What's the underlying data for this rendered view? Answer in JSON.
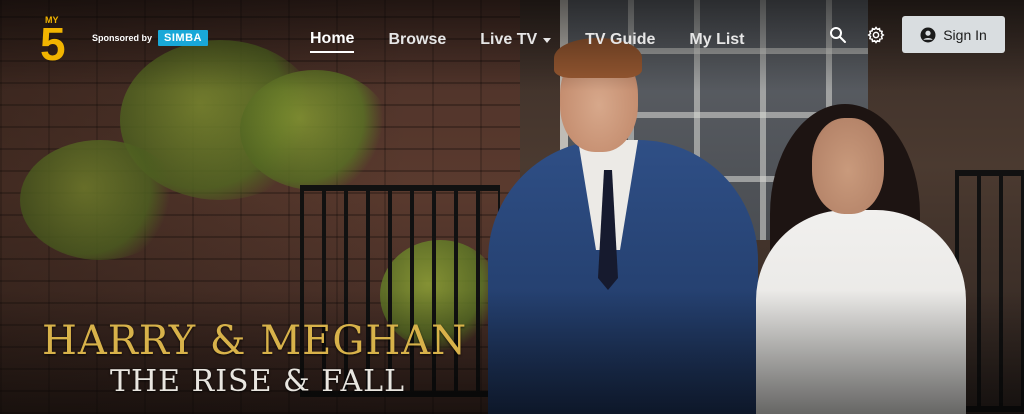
{
  "brand": {
    "logo_label": "5",
    "logo_prefix": "MY",
    "logo_color": "#f2b400",
    "sponsor_text": "Sponsored by",
    "sponsor_brand": "SIMBA",
    "sponsor_color": "#19a8d8"
  },
  "nav": {
    "items": [
      {
        "label": "Home",
        "active": true
      },
      {
        "label": "Browse",
        "active": false
      },
      {
        "label": "Live TV",
        "active": false,
        "has_dropdown": true
      },
      {
        "label": "TV Guide",
        "active": false
      },
      {
        "label": "My List",
        "active": false
      }
    ]
  },
  "actions": {
    "search_icon": "search-icon",
    "settings_icon": "gear-icon",
    "signin_label": "Sign In",
    "signin_icon": "user-circle-icon"
  },
  "hero": {
    "title_line1": "HARRY & MEGHAN",
    "title_line2": "THE RISE & FALL",
    "title_color": "#d8b24a"
  }
}
